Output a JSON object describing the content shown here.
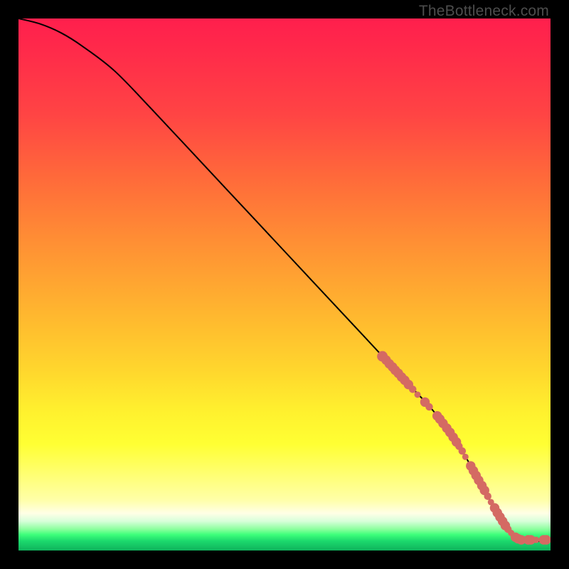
{
  "watermark": "TheBottleneck.com",
  "chart_data": {
    "type": "line",
    "title": "",
    "xlabel": "",
    "ylabel": "",
    "xlim": [
      0,
      100
    ],
    "ylim": [
      0,
      100
    ],
    "series": [
      {
        "name": "curve",
        "x": [
          0,
          4,
          8,
          12,
          18,
          25,
          35,
          45,
          55,
          65,
          73,
          78,
          82.5,
          86,
          90,
          94,
          100
        ],
        "y": [
          100,
          99.0,
          97.3,
          94.8,
          90.2,
          83.0,
          72.3,
          61.6,
          50.9,
          40.2,
          31.6,
          26.2,
          20.2,
          14.1,
          7.1,
          2.0,
          2.0
        ]
      }
    ],
    "markers": [
      {
        "x": 68.4,
        "y": 36.5,
        "r": 1.0
      },
      {
        "x": 69.1,
        "y": 35.8,
        "r": 0.9
      },
      {
        "x": 69.7,
        "y": 35.1,
        "r": 0.9
      },
      {
        "x": 70.3,
        "y": 34.5,
        "r": 0.9
      },
      {
        "x": 70.8,
        "y": 33.9,
        "r": 0.9
      },
      {
        "x": 71.4,
        "y": 33.3,
        "r": 0.9
      },
      {
        "x": 72.0,
        "y": 32.6,
        "r": 0.9
      },
      {
        "x": 72.6,
        "y": 32.0,
        "r": 0.9
      },
      {
        "x": 73.3,
        "y": 31.2,
        "r": 0.9
      },
      {
        "x": 74.1,
        "y": 30.3,
        "r": 0.7
      },
      {
        "x": 75.0,
        "y": 29.3,
        "r": 0.6
      },
      {
        "x": 76.4,
        "y": 27.9,
        "r": 0.9
      },
      {
        "x": 77.2,
        "y": 27.0,
        "r": 0.7
      },
      {
        "x": 78.7,
        "y": 25.3,
        "r": 0.9
      },
      {
        "x": 79.2,
        "y": 24.7,
        "r": 0.9
      },
      {
        "x": 79.8,
        "y": 23.9,
        "r": 0.9
      },
      {
        "x": 80.5,
        "y": 23.0,
        "r": 0.9
      },
      {
        "x": 81.1,
        "y": 22.2,
        "r": 0.9
      },
      {
        "x": 81.7,
        "y": 21.3,
        "r": 0.9
      },
      {
        "x": 82.3,
        "y": 20.4,
        "r": 0.9
      },
      {
        "x": 82.8,
        "y": 19.6,
        "r": 0.7
      },
      {
        "x": 83.4,
        "y": 18.7,
        "r": 0.7
      },
      {
        "x": 84.0,
        "y": 17.6,
        "r": 0.6
      },
      {
        "x": 85.0,
        "y": 15.9,
        "r": 0.9
      },
      {
        "x": 85.5,
        "y": 15.0,
        "r": 0.9
      },
      {
        "x": 86.0,
        "y": 14.1,
        "r": 0.9
      },
      {
        "x": 86.5,
        "y": 13.2,
        "r": 0.9
      },
      {
        "x": 87.1,
        "y": 12.2,
        "r": 0.9
      },
      {
        "x": 87.6,
        "y": 11.3,
        "r": 0.9
      },
      {
        "x": 88.2,
        "y": 10.2,
        "r": 0.7
      },
      {
        "x": 88.8,
        "y": 9.1,
        "r": 0.6
      },
      {
        "x": 89.5,
        "y": 8.0,
        "r": 0.9
      },
      {
        "x": 90.0,
        "y": 7.1,
        "r": 0.9
      },
      {
        "x": 90.5,
        "y": 6.3,
        "r": 0.9
      },
      {
        "x": 91.0,
        "y": 5.5,
        "r": 0.9
      },
      {
        "x": 91.5,
        "y": 4.7,
        "r": 0.9
      },
      {
        "x": 92.0,
        "y": 4.0,
        "r": 0.7
      },
      {
        "x": 92.6,
        "y": 3.3,
        "r": 0.6
      },
      {
        "x": 93.4,
        "y": 2.5,
        "r": 0.9
      },
      {
        "x": 93.9,
        "y": 2.2,
        "r": 0.9
      },
      {
        "x": 94.5,
        "y": 2.0,
        "r": 0.9
      },
      {
        "x": 95.0,
        "y": 2.0,
        "r": 0.6
      },
      {
        "x": 95.8,
        "y": 2.0,
        "r": 0.9
      },
      {
        "x": 96.3,
        "y": 2.0,
        "r": 0.9
      },
      {
        "x": 97.3,
        "y": 2.0,
        "r": 0.6
      },
      {
        "x": 98.7,
        "y": 2.0,
        "r": 0.9
      },
      {
        "x": 99.2,
        "y": 2.0,
        "r": 0.9
      }
    ],
    "marker_color": "#d46a63",
    "line_color": "#000000"
  }
}
